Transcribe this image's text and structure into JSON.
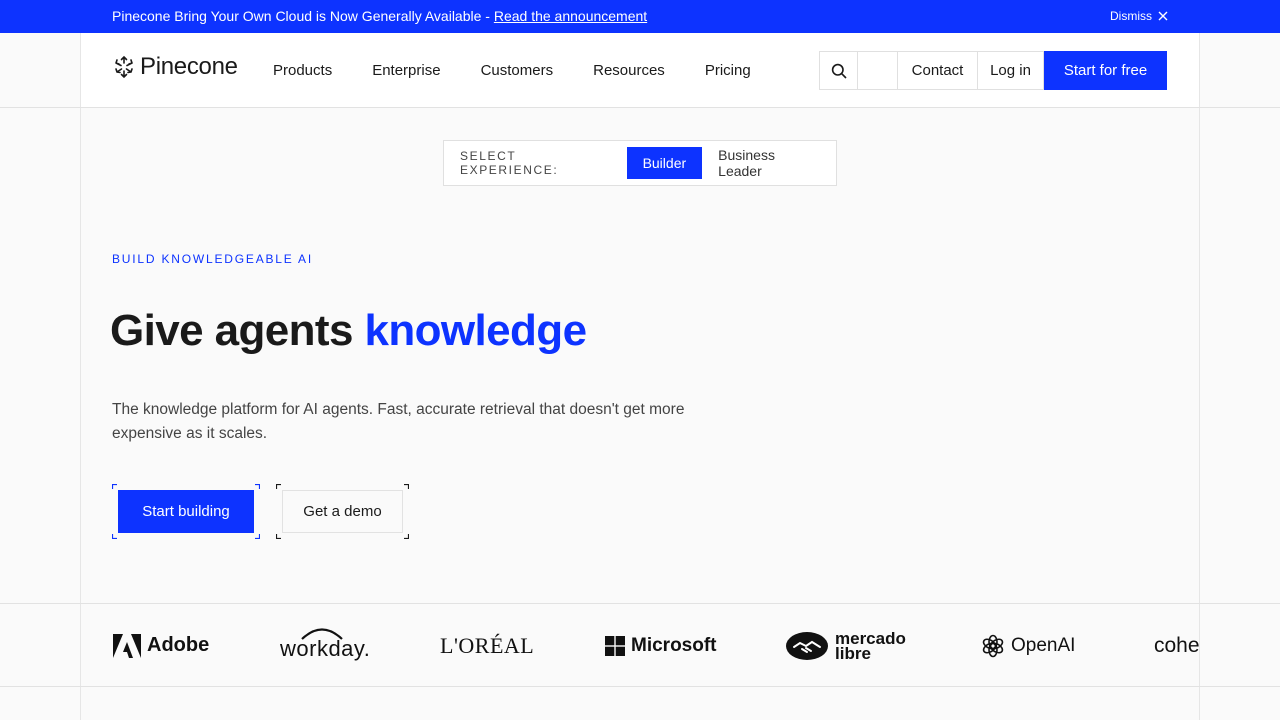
{
  "announcement": {
    "text": "Pinecone Bring Your Own Cloud is Now Generally Available - ",
    "link": "Read the announcement",
    "dismiss": "Dismiss"
  },
  "header": {
    "brand": "Pinecone",
    "nav": [
      "Products",
      "Enterprise",
      "Customers",
      "Resources",
      "Pricing"
    ],
    "contact": "Contact",
    "login": "Log in",
    "cta": "Start for free"
  },
  "experience": {
    "label": "SELECT EXPERIENCE:",
    "options": [
      "Builder",
      "Business Leader"
    ],
    "selected": "Builder"
  },
  "hero": {
    "eyebrow": "BUILD KNOWLEDGEABLE AI",
    "title_plain": "Give agents ",
    "title_accent": "knowledge",
    "subtitle": "The knowledge platform for AI agents. Fast, accurate retrieval that doesn't get more expensive as it scales.",
    "primary_cta": "Start building",
    "secondary_cta": "Get a demo"
  },
  "customers": [
    "Adobe",
    "workday.",
    "L'ORÉAL",
    "Microsoft",
    "mercado libre",
    "OpenAI",
    "cohere"
  ],
  "colors": {
    "accent": "#0d33ff",
    "background": "#fafafa",
    "text": "#1a1a1a"
  }
}
